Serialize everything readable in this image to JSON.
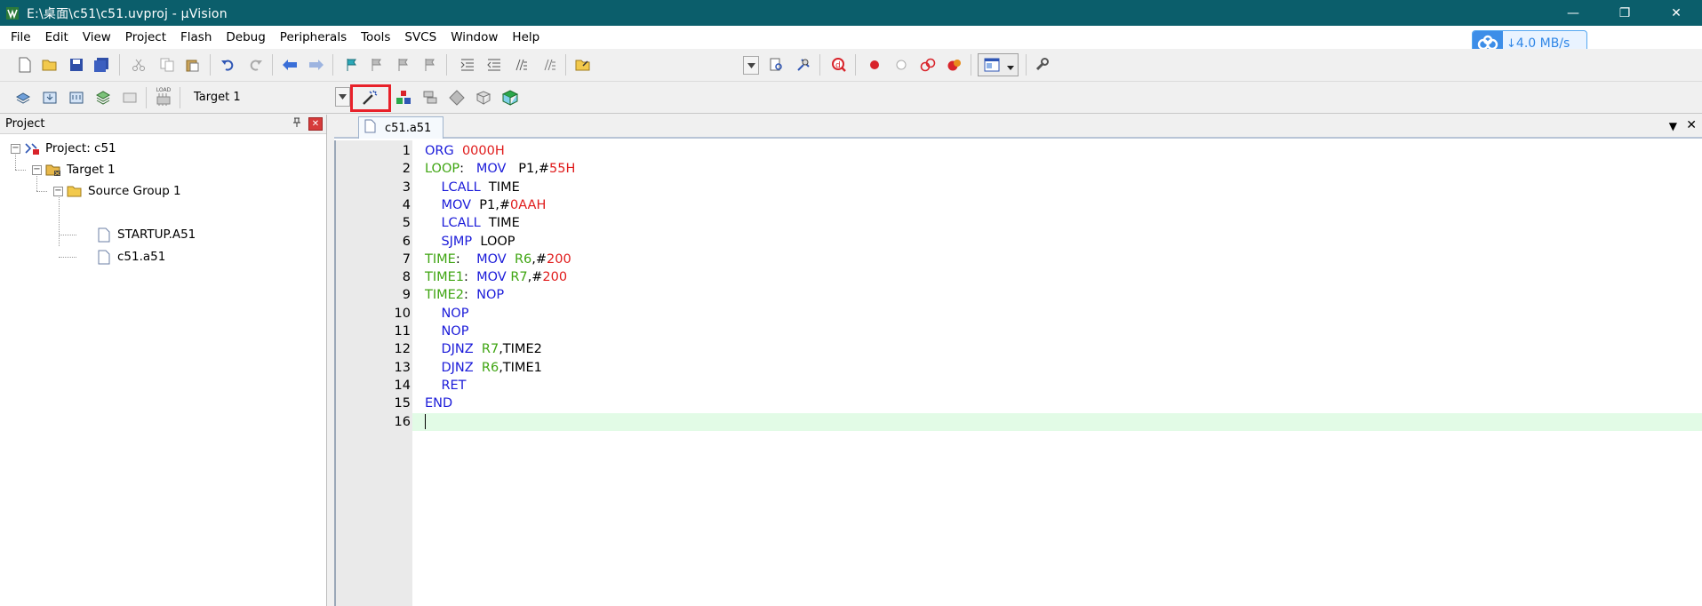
{
  "window": {
    "title": "E:\\桌面\\c51\\c51.uvproj - µVision",
    "minimize": "—",
    "restore": "❐",
    "close": "✕"
  },
  "menu": [
    "File",
    "Edit",
    "View",
    "Project",
    "Flash",
    "Debug",
    "Peripherals",
    "Tools",
    "SVCS",
    "Window",
    "Help"
  ],
  "speed_badge": {
    "arrow": "↓",
    "value": "4.0",
    "unit": "MB/s"
  },
  "build_toolbar": {
    "load_label": "LOAD",
    "target": "Target 1"
  },
  "project_panel": {
    "title": "Project",
    "pin": "⊞",
    "close": "✕",
    "tree": {
      "project": "Project: c51",
      "target": "Target 1",
      "group": "Source Group 1",
      "files": [
        "STARTUP.A51",
        "c51.a51"
      ]
    }
  },
  "editor": {
    "tab": "c51.a51",
    "tab_menu": "▼",
    "tab_close": "✕",
    "current_line": 16,
    "lines": [
      [
        [
          "kw",
          "ORG"
        ],
        [
          "pl",
          "  "
        ],
        [
          "num",
          "0000H"
        ]
      ],
      [
        [
          "lb",
          "LOOP"
        ],
        [
          "pl",
          ":   "
        ],
        [
          "kw",
          "MOV"
        ],
        [
          "pl",
          "   P1,#"
        ],
        [
          "num",
          "55H"
        ]
      ],
      [
        [
          "pl",
          "    "
        ],
        [
          "kw",
          "LCALL"
        ],
        [
          "pl",
          "  TIME"
        ]
      ],
      [
        [
          "pl",
          "    "
        ],
        [
          "kw",
          "MOV"
        ],
        [
          "pl",
          "  P1,#"
        ],
        [
          "num",
          "0AAH"
        ]
      ],
      [
        [
          "pl",
          "    "
        ],
        [
          "kw",
          "LCALL"
        ],
        [
          "pl",
          "  TIME"
        ]
      ],
      [
        [
          "pl",
          "    "
        ],
        [
          "kw",
          "SJMP"
        ],
        [
          "pl",
          "  LOOP"
        ]
      ],
      [
        [
          "lb",
          "TIME"
        ],
        [
          "pl",
          ":    "
        ],
        [
          "kw",
          "MOV"
        ],
        [
          "pl",
          "  "
        ],
        [
          "lb",
          "R6"
        ],
        [
          "pl",
          ",#"
        ],
        [
          "num",
          "200"
        ]
      ],
      [
        [
          "lb",
          "TIME1"
        ],
        [
          "pl",
          ":  "
        ],
        [
          "kw",
          "MOV"
        ],
        [
          "pl",
          " "
        ],
        [
          "lb",
          "R7"
        ],
        [
          "pl",
          ",#"
        ],
        [
          "num",
          "200"
        ]
      ],
      [
        [
          "lb",
          "TIME2"
        ],
        [
          "pl",
          ":  "
        ],
        [
          "kw",
          "NOP"
        ]
      ],
      [
        [
          "pl",
          "    "
        ],
        [
          "kw",
          "NOP"
        ]
      ],
      [
        [
          "pl",
          "    "
        ],
        [
          "kw",
          "NOP"
        ]
      ],
      [
        [
          "pl",
          "    "
        ],
        [
          "kw",
          "DJNZ"
        ],
        [
          "pl",
          "  "
        ],
        [
          "lb",
          "R7"
        ],
        [
          "pl",
          ",TIME2"
        ]
      ],
      [
        [
          "pl",
          "    "
        ],
        [
          "kw",
          "DJNZ"
        ],
        [
          "pl",
          "  "
        ],
        [
          "lb",
          "R6"
        ],
        [
          "pl",
          ",TIME1"
        ]
      ],
      [
        [
          "pl",
          "    "
        ],
        [
          "kw",
          "RET"
        ]
      ],
      [
        [
          "kw",
          "END"
        ]
      ],
      []
    ]
  }
}
